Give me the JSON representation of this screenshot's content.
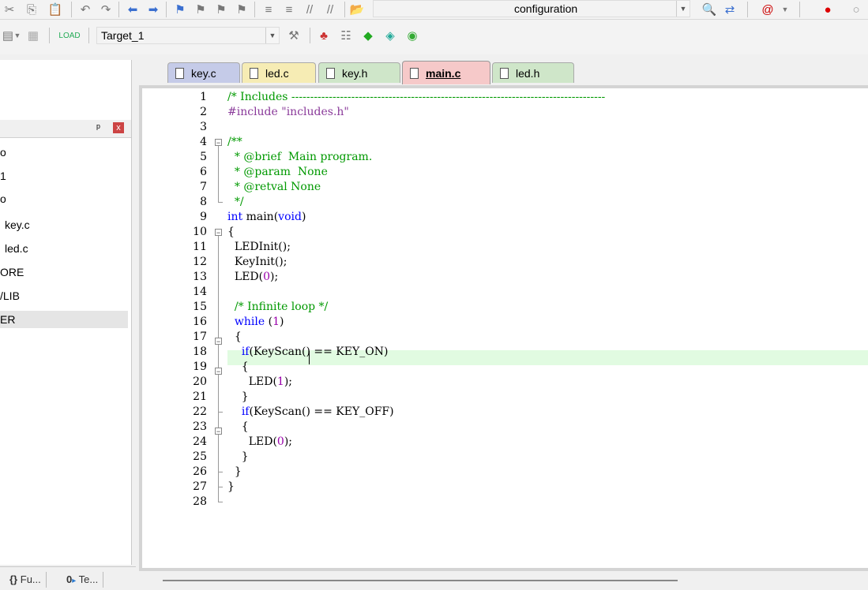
{
  "toolbar": {
    "find_combo_value": "configuration",
    "target_combo_value": "Target_1"
  },
  "project_panel": {
    "pin_glyph": "ᵖ",
    "close_glyph": "x",
    "items": [
      {
        "label": "o",
        "selected": false
      },
      {
        "label": "1",
        "selected": false
      },
      {
        "label": "o",
        "selected": false
      },
      {
        "label": "key.c",
        "selected": false
      },
      {
        "label": "led.c",
        "selected": false
      },
      {
        "label": "ORE",
        "selected": false
      },
      {
        "label": "/LIB",
        "selected": false
      },
      {
        "label": "ER",
        "selected": true
      }
    ],
    "bottom_tabs": [
      {
        "icon": "{}",
        "label": "Fu..."
      },
      {
        "icon": "0",
        "label": "Te..."
      }
    ]
  },
  "editor": {
    "tabs": [
      {
        "label": "key.c",
        "color": "#c5cbe8",
        "active": false
      },
      {
        "label": "led.c",
        "color": "#f6ecb4",
        "active": false
      },
      {
        "label": "key.h",
        "color": "#cfe6c9",
        "active": false
      },
      {
        "label": "main.c",
        "color": "#f6c9c9",
        "active": true
      },
      {
        "label": "led.h",
        "color": "#cfe6c9",
        "active": false
      }
    ],
    "lines": [
      {
        "n": "1",
        "text": "/* Includes ------------------------------------------------------------------------------------"
      },
      {
        "n": "2",
        "text": "#include \"includes.h\""
      },
      {
        "n": "3",
        "text": ""
      },
      {
        "n": "4",
        "text": "/**"
      },
      {
        "n": "5",
        "text": "  * @brief  Main program."
      },
      {
        "n": "6",
        "text": "  * @param  None"
      },
      {
        "n": "7",
        "text": "  * @retval None"
      },
      {
        "n": "8",
        "text": "  */"
      },
      {
        "n": "9",
        "text": "int main(void)"
      },
      {
        "n": "10",
        "text": "{"
      },
      {
        "n": "11",
        "text": "  LEDInit();"
      },
      {
        "n": "12",
        "text": "  KeyInit();"
      },
      {
        "n": "13",
        "text": "  LED(0);"
      },
      {
        "n": "14",
        "text": ""
      },
      {
        "n": "15",
        "text": "  /* Infinite loop */"
      },
      {
        "n": "16",
        "text": "  while (1)"
      },
      {
        "n": "17",
        "text": "  {"
      },
      {
        "n": "18",
        "text": "    if(KeyScan() == KEY_ON)"
      },
      {
        "n": "19",
        "text": "    {"
      },
      {
        "n": "20",
        "text": "      LED(1);"
      },
      {
        "n": "21",
        "text": "    }"
      },
      {
        "n": "22",
        "text": "    if(KeyScan() == KEY_OFF)"
      },
      {
        "n": "23",
        "text": "    {"
      },
      {
        "n": "24",
        "text": "      LED(0);"
      },
      {
        "n": "25",
        "text": "    }"
      },
      {
        "n": "26",
        "text": "  }"
      },
      {
        "n": "27",
        "text": "}"
      },
      {
        "n": "28",
        "text": ""
      }
    ]
  }
}
